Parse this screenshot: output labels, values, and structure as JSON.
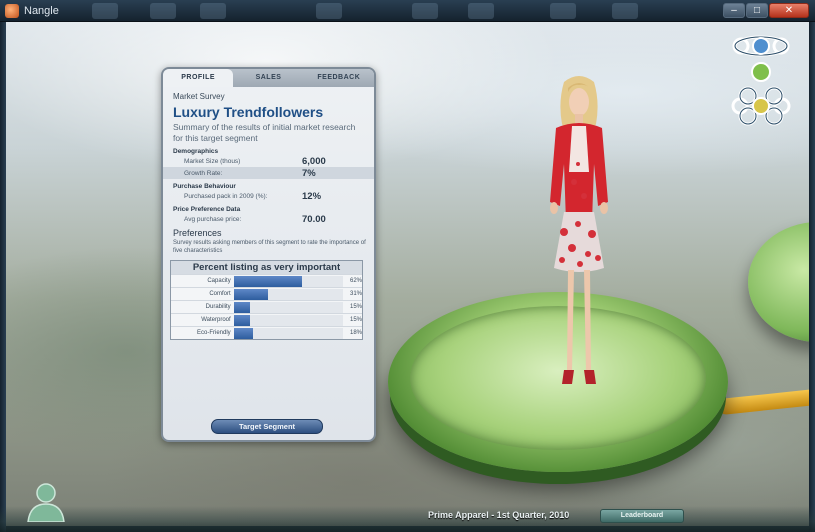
{
  "window": {
    "title": "Nangle"
  },
  "panel": {
    "tabs": [
      "PROFILE",
      "SALES",
      "FEEDBACK"
    ],
    "section": "Market Survey",
    "title": "Luxury Trendfollowers",
    "subtitle": "Summary of the results of initial market research for this target segment",
    "demographics": {
      "heading": "Demographics",
      "rows": [
        {
          "label": "Market Size (thous)",
          "value": "6,000"
        },
        {
          "label": "Growth Rate:",
          "value": "7%"
        }
      ]
    },
    "purchase": {
      "heading": "Purchase Behaviour",
      "rows": [
        {
          "label": "Purchased pack in 2009 (%):",
          "value": "12%"
        }
      ]
    },
    "price": {
      "heading": "Price Preference Data",
      "rows": [
        {
          "label": "Avg purchase price:",
          "value": "70.00"
        }
      ]
    },
    "preferences": {
      "heading": "Preferences",
      "text": "Survey results asking members of this segment to rate the importance of five characteristics"
    },
    "percent_box": {
      "title": "Percent listing as very important",
      "items": [
        {
          "label": "Capacity",
          "pct": "62%",
          "value": 62
        },
        {
          "label": "Comfort",
          "pct": "31%",
          "value": 31
        },
        {
          "label": "Durability",
          "pct": "15%",
          "value": 15
        },
        {
          "label": "Waterproof",
          "pct": "15%",
          "value": 15
        },
        {
          "label": "Eco-Friendly",
          "pct": "18%",
          "value": 18
        }
      ]
    },
    "target_button": "Target Segment"
  },
  "bottom": {
    "status": "Prime Apparel - 1st Quarter, 2010",
    "leaderboard": "Leaderboard"
  },
  "colors": {
    "accent_blue": "#2e5d9e",
    "platform_green": "#9ac86f"
  }
}
